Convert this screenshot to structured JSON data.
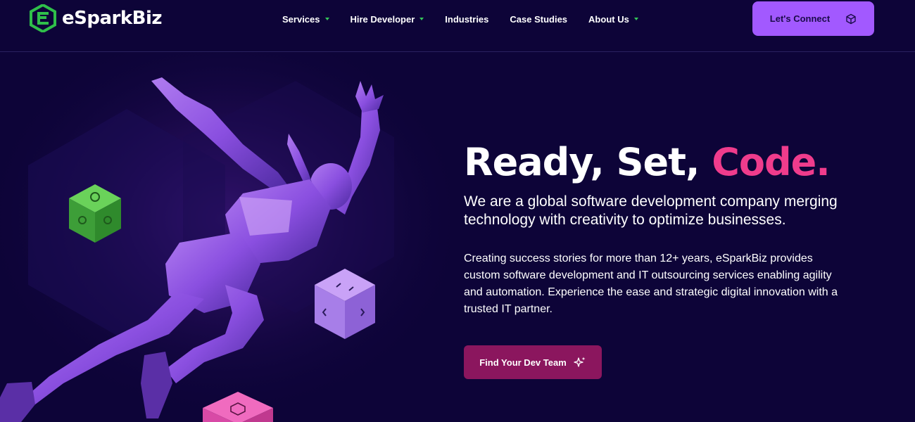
{
  "header": {
    "logo_text": "eSparkBiz",
    "logo_icon": "esparkbiz-logo-icon",
    "nav": [
      {
        "label": "Services",
        "has_dropdown": true
      },
      {
        "label": "Hire Developer",
        "has_dropdown": true
      },
      {
        "label": "Industries",
        "has_dropdown": false
      },
      {
        "label": "Case Studies",
        "has_dropdown": false
      },
      {
        "label": "About Us",
        "has_dropdown": true
      }
    ],
    "connect_label": "Let's Connect",
    "connect_icon": "cube-icon"
  },
  "hero": {
    "headline_part1": "Ready, Set, ",
    "headline_accent": "Code.",
    "subhead": "We are a global software development company merging technology with creativity to optimize businesses.",
    "description": "Creating success stories for more than 12+ years, eSparkBiz provides custom software development and IT outsourcing services enabling agility and automation. Experience the ease and strategic digital innovation with a trusted IT partner.",
    "cta_label": "Find Your Dev Team",
    "cta_icon": "sparkle-icon"
  },
  "colors": {
    "background": "#0d0438",
    "accent_pink": "#ef3c8c",
    "connect_button": "#a259ff",
    "cta_button": "#8b165e",
    "logo_green": "#34c759"
  }
}
